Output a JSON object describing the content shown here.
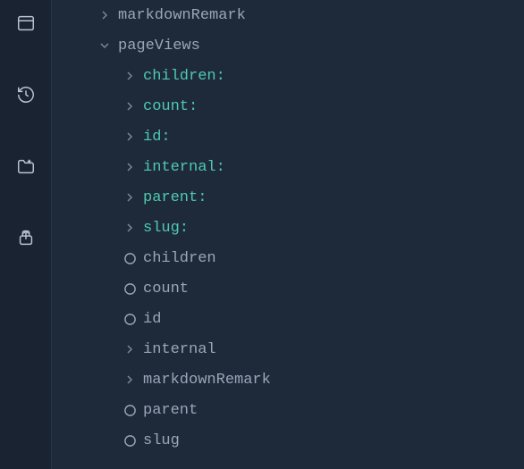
{
  "sidebar": {
    "icons": [
      {
        "name": "panel-icon"
      },
      {
        "name": "history-icon"
      },
      {
        "name": "folder-icon"
      },
      {
        "name": "share-icon"
      }
    ]
  },
  "tree": {
    "items": [
      {
        "indent": 0,
        "marker": "arrow-right",
        "label": "markdownRemark",
        "labelClass": "gray"
      },
      {
        "indent": 0,
        "marker": "arrow-down",
        "label": "pageViews",
        "labelClass": "gray"
      },
      {
        "indent": 2,
        "marker": "arrow-right",
        "label": "children:",
        "labelClass": "teal"
      },
      {
        "indent": 2,
        "marker": "arrow-right",
        "label": "count:",
        "labelClass": "teal"
      },
      {
        "indent": 2,
        "marker": "arrow-right",
        "label": "id:",
        "labelClass": "teal"
      },
      {
        "indent": 2,
        "marker": "arrow-right",
        "label": "internal:",
        "labelClass": "teal"
      },
      {
        "indent": 2,
        "marker": "arrow-right",
        "label": "parent:",
        "labelClass": "teal"
      },
      {
        "indent": 2,
        "marker": "arrow-right",
        "label": "slug:",
        "labelClass": "teal"
      },
      {
        "indent": 2,
        "marker": "circle",
        "label": "children",
        "labelClass": "gray"
      },
      {
        "indent": 2,
        "marker": "circle",
        "label": "count",
        "labelClass": "gray"
      },
      {
        "indent": 2,
        "marker": "circle",
        "label": "id",
        "labelClass": "gray"
      },
      {
        "indent": 2,
        "marker": "arrow-right",
        "label": "internal",
        "labelClass": "gray"
      },
      {
        "indent": 2,
        "marker": "arrow-right",
        "label": "markdownRemark",
        "labelClass": "gray"
      },
      {
        "indent": 2,
        "marker": "circle",
        "label": "parent",
        "labelClass": "gray"
      },
      {
        "indent": 2,
        "marker": "circle",
        "label": "slug",
        "labelClass": "gray"
      }
    ]
  }
}
